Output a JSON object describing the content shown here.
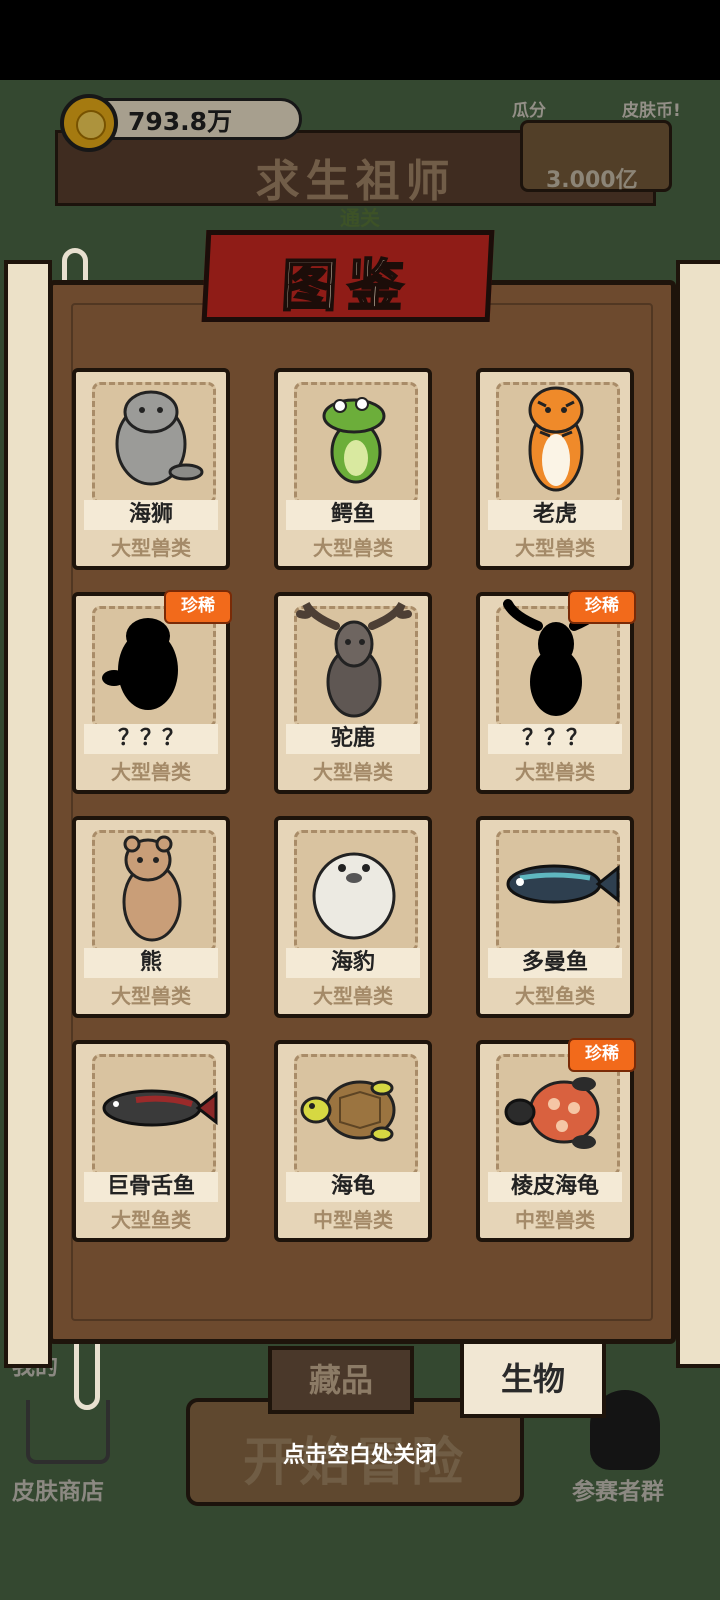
{
  "header": {
    "coins": "793.8万",
    "game_title": "求生祖师",
    "subtitle": "通关",
    "promo_left": "瓜分",
    "promo_right": "皮肤币!",
    "prize_amount": "3.000亿"
  },
  "encyclopedia": {
    "title": "图鉴",
    "rare_label": "珍稀",
    "cards": [
      {
        "name": "海狮",
        "category": "大型兽类",
        "rare": false,
        "icon": "sea-lion-icon"
      },
      {
        "name": "鳄鱼",
        "category": "大型兽类",
        "rare": false,
        "icon": "crocodile-icon"
      },
      {
        "name": "老虎",
        "category": "大型兽类",
        "rare": false,
        "icon": "tiger-icon"
      },
      {
        "name": "？？？",
        "category": "大型兽类",
        "rare": true,
        "icon": "unknown-silhouette-icon"
      },
      {
        "name": "驼鹿",
        "category": "大型兽类",
        "rare": false,
        "icon": "moose-icon"
      },
      {
        "name": "？？？",
        "category": "大型兽类",
        "rare": true,
        "icon": "unknown-moose-silhouette-icon"
      },
      {
        "name": "熊",
        "category": "大型兽类",
        "rare": false,
        "icon": "bear-icon"
      },
      {
        "name": "海豹",
        "category": "大型兽类",
        "rare": false,
        "icon": "seal-icon"
      },
      {
        "name": "多曼鱼",
        "category": "大型鱼类",
        "rare": false,
        "icon": "toman-fish-icon"
      },
      {
        "name": "巨骨舌鱼",
        "category": "大型鱼类",
        "rare": false,
        "icon": "arapaima-icon"
      },
      {
        "name": "海龟",
        "category": "中型兽类",
        "rare": false,
        "icon": "sea-turtle-icon"
      },
      {
        "name": "棱皮海龟",
        "category": "中型兽类",
        "rare": true,
        "icon": "leatherback-turtle-icon"
      }
    ],
    "tabs": [
      {
        "label": "藏品",
        "active": false
      },
      {
        "label": "生物",
        "active": true
      }
    ]
  },
  "background": {
    "my_label": "我的",
    "skin_shop": "皮肤商店",
    "start_adventure": "开始冒险",
    "contest_group": "参赛者群"
  },
  "close_hint": "点击空白处关闭",
  "colors": {
    "banner_red": "#8f1c17",
    "rare_orange": "#f26a1b",
    "board_brown": "#6d4a2e",
    "card_bg": "#e6d5b8"
  }
}
